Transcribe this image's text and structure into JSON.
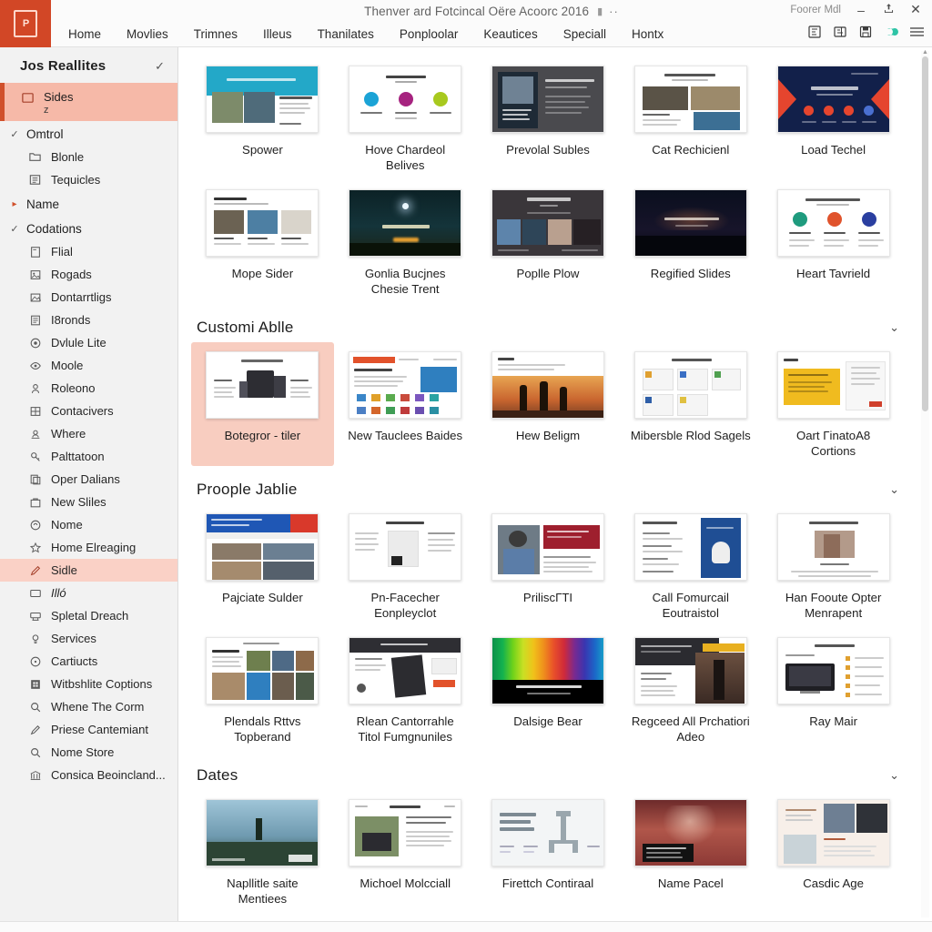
{
  "window": {
    "doc_title": "Thenver ard Fotcincal Oëre Acoorc 2016",
    "doc_title_icon": "pin-icon",
    "doc_title_dots": "··",
    "account_label": "Foorer Mdl",
    "minimize": "–",
    "restore": "❐",
    "close": "✕",
    "app_logo_text": "P"
  },
  "menu": {
    "items": [
      "Home",
      "Movlies",
      "Trimnes",
      "Illeus",
      "Thanilates",
      "Ponploolar",
      "Keautices",
      "Speciall",
      "Hontx"
    ]
  },
  "toolbar_icons": [
    {
      "name": "comments-icon"
    },
    {
      "name": "notes-icon"
    },
    {
      "name": "save-icon"
    },
    {
      "name": "presence-icon"
    },
    {
      "name": "hamburger-menu-icon"
    }
  ],
  "sidebar": {
    "header": {
      "label": "Jos Reallites",
      "check": "✓"
    },
    "selected_item": {
      "label": "Sides",
      "sub": "z",
      "icon": "slide-icon"
    },
    "groups": [
      {
        "label": "Omtrol",
        "caret": "✓",
        "items": [
          {
            "label": "Blonle",
            "icon": "folder-icon"
          },
          {
            "label": "Tequicles",
            "icon": "list-icon"
          }
        ]
      },
      {
        "label": "Name",
        "caret": "▸",
        "caret_color": "red",
        "items": []
      },
      {
        "label": "Codations",
        "caret": "✓",
        "items": [
          {
            "label": "Flial",
            "icon": "page-icon"
          },
          {
            "label": "Rogads",
            "icon": "image-icon"
          },
          {
            "label": "Dontarrtligs",
            "icon": "picture-icon"
          },
          {
            "label": "I8ronds",
            "icon": "document-icon"
          },
          {
            "label": "Dvlule Lite",
            "icon": "target-icon"
          },
          {
            "label": "Moole",
            "icon": "eye-icon"
          },
          {
            "label": "Roleono",
            "icon": "person-icon"
          },
          {
            "label": "Contacivers",
            "icon": "table-icon"
          },
          {
            "label": "Where",
            "icon": "group-icon"
          },
          {
            "label": "Palttatoon",
            "icon": "key-icon"
          },
          {
            "label": "Oper Dalians",
            "icon": "copy-icon"
          },
          {
            "label": "New Sliles",
            "icon": "bag-icon"
          },
          {
            "label": "Nome",
            "icon": "shape-icon"
          },
          {
            "label": "Home Elreaging",
            "icon": "star-icon"
          },
          {
            "label": "Sidle",
            "icon": "pencil-icon",
            "selected": true
          },
          {
            "label": "Illó",
            "icon": "monitor-icon",
            "italic": true
          },
          {
            "label": "Spletal Dreach",
            "icon": "projector-icon"
          },
          {
            "label": "Services",
            "icon": "bulb-icon"
          },
          {
            "label": "Cartiucts",
            "icon": "circle-dot-icon"
          },
          {
            "label": "Witbshlite Coptions",
            "icon": "grid-icon"
          },
          {
            "label": "Whene The Corm",
            "icon": "search-icon"
          },
          {
            "label": "Priese Cantemiant",
            "icon": "pen-icon"
          },
          {
            "label": "Nome Store",
            "icon": "search-icon"
          },
          {
            "label": "Consica Beoincland...",
            "icon": "bank-icon"
          }
        ]
      }
    ]
  },
  "sections": [
    {
      "id": "top",
      "title": null,
      "cards": [
        {
          "label": "Spower",
          "art": "teal-header"
        },
        {
          "label": "Hove Chardeol Belives",
          "art": "three-circles"
        },
        {
          "label": "Prevolal Subles",
          "art": "dark-portrait"
        },
        {
          "label": "Cat Rechicienl",
          "art": "photo-grid-light"
        },
        {
          "label": "Load Techel",
          "art": "navy-arrows"
        },
        {
          "label": "Mope Sider",
          "art": "three-photos"
        },
        {
          "label": "Gonlia Bucjnes Chesie Trent",
          "art": "night-forest"
        },
        {
          "label": "Poplle Plow",
          "art": "dark-gallery"
        },
        {
          "label": "Regified Slides",
          "art": "dark-city"
        },
        {
          "label": "Heart Tavrield",
          "art": "three-icons"
        }
      ]
    },
    {
      "id": "customizable",
      "title": "Customi Ablle",
      "chevron": "⌄",
      "cards": [
        {
          "label": "Botegror - tiler",
          "art": "devices",
          "selected": true
        },
        {
          "label": "New Tauclees Baides",
          "art": "orange-bar-icons"
        },
        {
          "label": "Hew Beligm",
          "art": "sunset-silhouette"
        },
        {
          "label": "Mibersble Rlod Sagels",
          "art": "card-list"
        },
        {
          "label": "Oart ΓinatoA8 Cortions",
          "art": "yellow-block"
        }
      ]
    },
    {
      "id": "people",
      "title": "Proople Jablie",
      "chevron": "⌄",
      "cards": [
        {
          "label": "Pajciate Sulder",
          "art": "blue-red-collage"
        },
        {
          "label": "Pn-Facecher Eonpleyclot",
          "art": "doc-columns"
        },
        {
          "label": "PriliscΓTI",
          "art": "portrait-red"
        },
        {
          "label": "Call Fomurcail Eoutraistol",
          "art": "blue-panel"
        },
        {
          "label": "Han Fooute Opter Menrapent",
          "art": "woman-photo"
        },
        {
          "label": "Plendals Rttvs Topberand",
          "art": "photo-mosaic"
        },
        {
          "label": "Rlean Cantorrahle Titol Fumgnuniles",
          "art": "dark-bar-tablet"
        },
        {
          "label": "Dalsige Bear",
          "art": "rainbow-spectrum"
        },
        {
          "label": "Regceed All Prchatiori Adeo",
          "art": "dark-figure"
        },
        {
          "label": "Ray Mair",
          "art": "tv-list"
        }
      ]
    },
    {
      "id": "dates",
      "title": "Dates",
      "chevron": "⌄",
      "cards": [
        {
          "label": "Napllitle saite Mentiees",
          "art": "runner-photo"
        },
        {
          "label": "Michoel Molcciall",
          "art": "laptop-article"
        },
        {
          "label": "Firettch Contiraal",
          "art": "diagram-light"
        },
        {
          "label": "Name Pacel",
          "art": "red-dramatic"
        },
        {
          "label": "Casdic Age",
          "art": "team-portraits"
        }
      ]
    }
  ],
  "colors": {
    "accent": "#d24726",
    "selection": "#f6b9a8",
    "selection_soft": "#f8cdc0",
    "sidebar_bg": "#f2f2f2",
    "presence_green": "#2ec4a6"
  },
  "scrollbar": {
    "name": "vertical-scrollbar"
  }
}
